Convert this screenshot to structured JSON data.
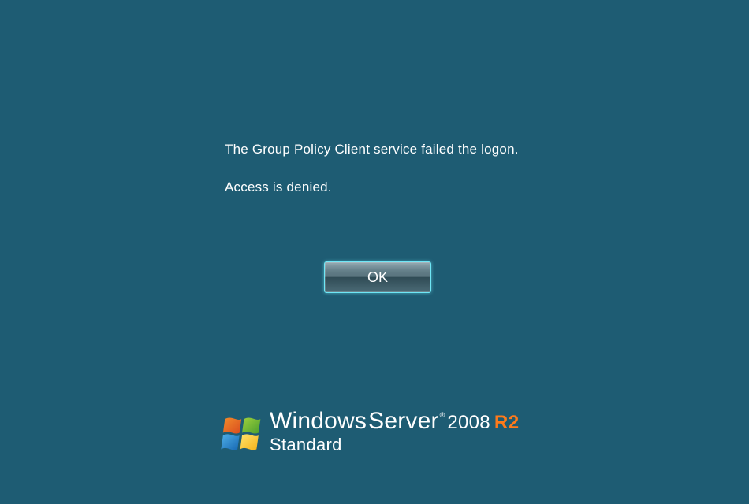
{
  "error": {
    "line1": "The Group Policy Client service failed the logon.",
    "line2": "Access is denied."
  },
  "button": {
    "ok_label": "OK"
  },
  "branding": {
    "windows": "Windows",
    "server": "Server",
    "registered": "®",
    "year": "2008",
    "r2": "R2",
    "edition": "Standard"
  }
}
